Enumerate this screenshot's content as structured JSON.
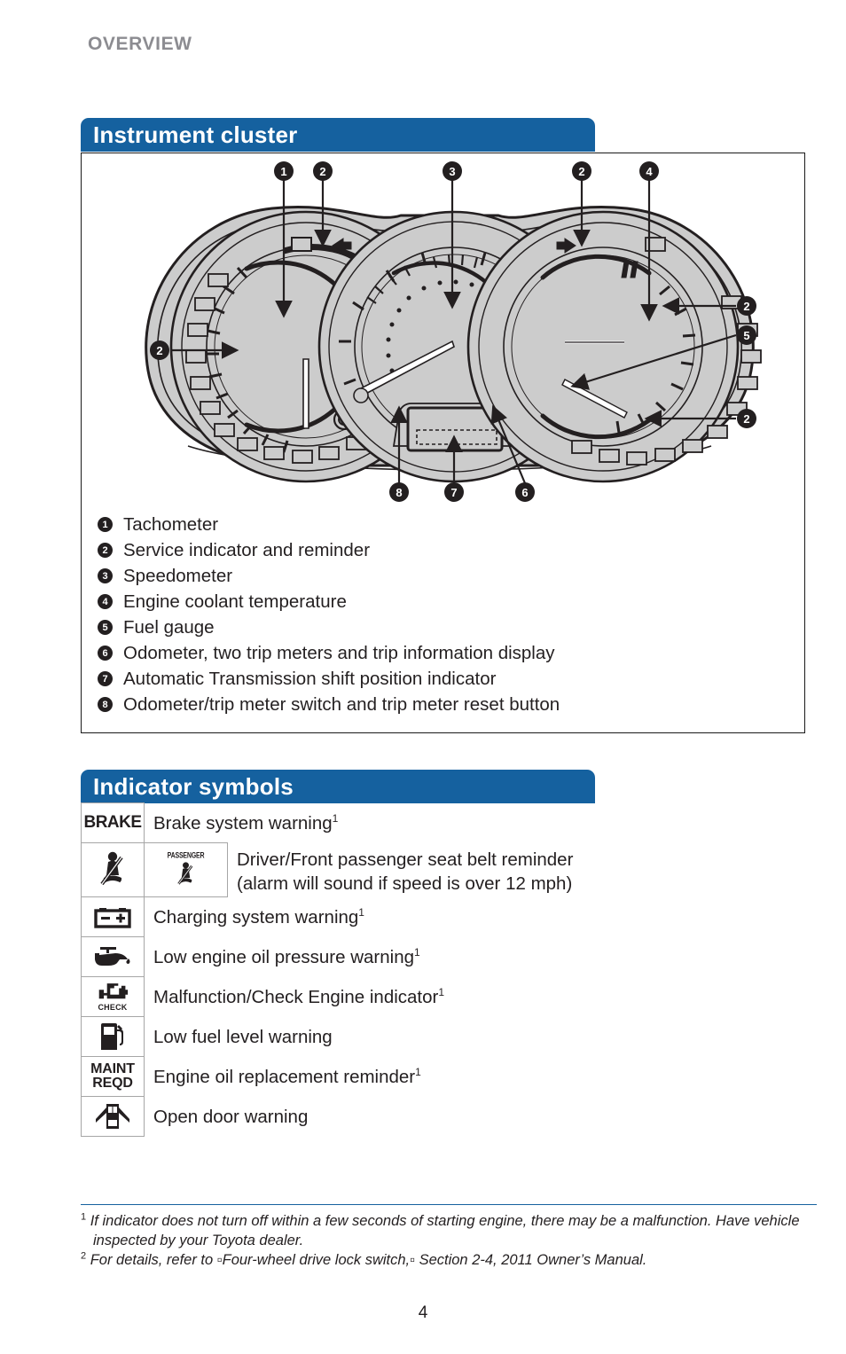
{
  "running_head": "OVERVIEW",
  "page_number": "4",
  "colors": {
    "header_blue": "#15619f",
    "running_head_gray": "#8c8c91",
    "text_black": "#231f20",
    "cluster_fill": "#cccccc"
  },
  "sections": {
    "cluster": {
      "title": "Instrument cluster",
      "callouts": [
        {
          "n": "1",
          "label": "Tachometer"
        },
        {
          "n": "2",
          "label": "Service indicator and reminder"
        },
        {
          "n": "3",
          "label": "Speedometer"
        },
        {
          "n": "4",
          "label": "Engine coolant temperature"
        },
        {
          "n": "5",
          "label": "Fuel gauge"
        },
        {
          "n": "6",
          "label": "Odometer, two trip meters and trip information display"
        },
        {
          "n": "7",
          "label": "Automatic Transmission shift position indicator"
        },
        {
          "n": "8",
          "label": "Odometer/trip meter switch and trip meter reset button"
        }
      ],
      "figure_markers": [
        "1",
        "2",
        "3",
        "2",
        "4",
        "2",
        "5",
        "2",
        "2",
        "8",
        "7",
        "6"
      ]
    },
    "symbols": {
      "title": "Indicator symbols",
      "rows": [
        {
          "icon": "brake-warning-icon",
          "icon_text": "BRAKE",
          "label": "Brake system warning",
          "footnote": "1"
        },
        {
          "icon": "seatbelt-reminder-icon",
          "icon2": "passenger-seatbelt-reminder-icon",
          "icon2_text": "PASSENGER",
          "label_line1": "Driver/Front passenger seat belt reminder",
          "label_line2": "(alarm will sound if speed is over 12 mph)",
          "footnote": ""
        },
        {
          "icon": "battery-charging-icon",
          "label": "Charging system warning",
          "footnote": "1"
        },
        {
          "icon": "oil-pressure-icon",
          "label": "Low engine oil pressure warning",
          "footnote": "1"
        },
        {
          "icon": "check-engine-icon",
          "icon_text": "CHECK",
          "label": "Malfunction/Check Engine indicator",
          "footnote": "1"
        },
        {
          "icon": "fuel-pump-icon",
          "label": "Low fuel level warning",
          "footnote": ""
        },
        {
          "icon": "maint-reqd-icon",
          "icon_text_line1": "MAINT",
          "icon_text_line2": "REQD",
          "label": "Engine oil replacement reminder",
          "footnote": "1"
        },
        {
          "icon": "open-door-icon",
          "label": "Open door warning",
          "footnote": ""
        }
      ]
    }
  },
  "footnotes": [
    {
      "marker": "1",
      "text": "If indicator does not turn off within a few seconds of starting engine, there may be a malfunction. Have vehicle inspected by your Toyota dealer."
    },
    {
      "marker": "2",
      "text": "For details, refer to ▫Four-wheel drive lock switch,▫ Section 2-4, 2011 Owner’s Manual."
    }
  ]
}
